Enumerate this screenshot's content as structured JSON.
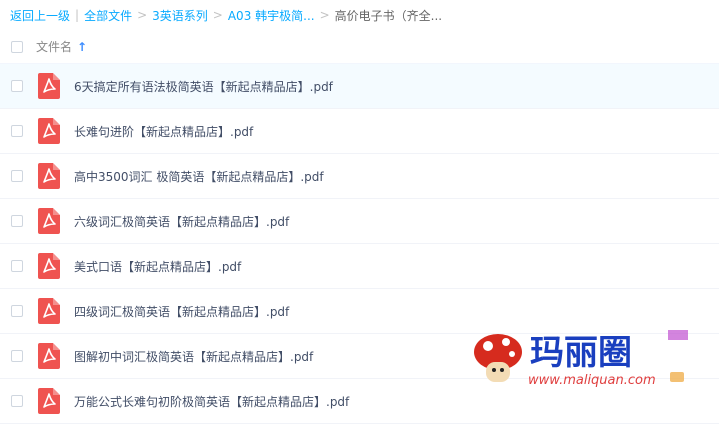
{
  "breadcrumb": {
    "back": "返回上一级",
    "sep1": "|",
    "all_files": "全部文件",
    "sep2": ">",
    "level1": "3英语系列",
    "sep3": ">",
    "level2": "A03 韩宇极简...",
    "sep4": ">",
    "current": "高价电子书（齐全..."
  },
  "table": {
    "column_name": "文件名",
    "sort_icon": "arrow-up-icon"
  },
  "files": [
    {
      "name": "6天搞定所有语法极简英语【新起点精品店】.pdf"
    },
    {
      "name": "长难句进阶【新起点精品店】.pdf"
    },
    {
      "name": "高中3500词汇 极简英语【新起点精品店】.pdf"
    },
    {
      "name": "六级词汇极简英语【新起点精品店】.pdf"
    },
    {
      "name": "美式口语【新起点精品店】.pdf"
    },
    {
      "name": "四级词汇极简英语【新起点精品店】.pdf"
    },
    {
      "name": "图解初中词汇极简英语【新起点精品店】.pdf"
    },
    {
      "name": "万能公式长难句初阶极简英语【新起点精品店】.pdf"
    }
  ],
  "watermark": {
    "brand": "玛丽圈",
    "url": "www.maliquan.com"
  },
  "colors": {
    "link": "#09aaff",
    "pdf_icon": "#ef5350",
    "row_highlight": "#f4fbff"
  }
}
